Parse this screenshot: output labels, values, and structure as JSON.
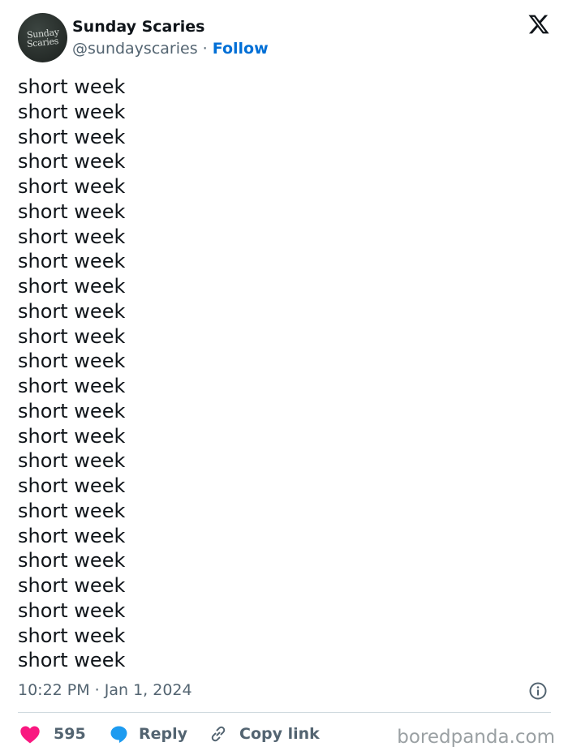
{
  "account": {
    "display_name": "Sunday Scaries",
    "handle": "@sundayscaries",
    "separator": "·",
    "follow_label": "Follow",
    "avatar_text": [
      "Sunday",
      "Scaries"
    ]
  },
  "tweet": {
    "lines": [
      "short week",
      "short week",
      "short week",
      "short week",
      "short week",
      "short week",
      "short week",
      "short week",
      "short week",
      "short week",
      "short week",
      "short week",
      "short week",
      "short week",
      "short week",
      "short week",
      "short week",
      "short week",
      "short week",
      "short week",
      "short week",
      "short week",
      "short week",
      "short week"
    ],
    "timestamp": "10:22 PM · Jan 1, 2024"
  },
  "actions": {
    "like_count": "595",
    "reply_label": "Reply",
    "copy_label": "Copy link"
  },
  "icons": {
    "platform": "x-logo-icon",
    "info": "info-icon",
    "like": "heart-icon",
    "reply": "reply-bubble-icon",
    "copy": "link-icon"
  },
  "colors": {
    "like": "#f91880",
    "reply": "#1d9bf0",
    "follow": "#006fd6",
    "muted": "#536471"
  },
  "watermark": "boredpanda.com"
}
